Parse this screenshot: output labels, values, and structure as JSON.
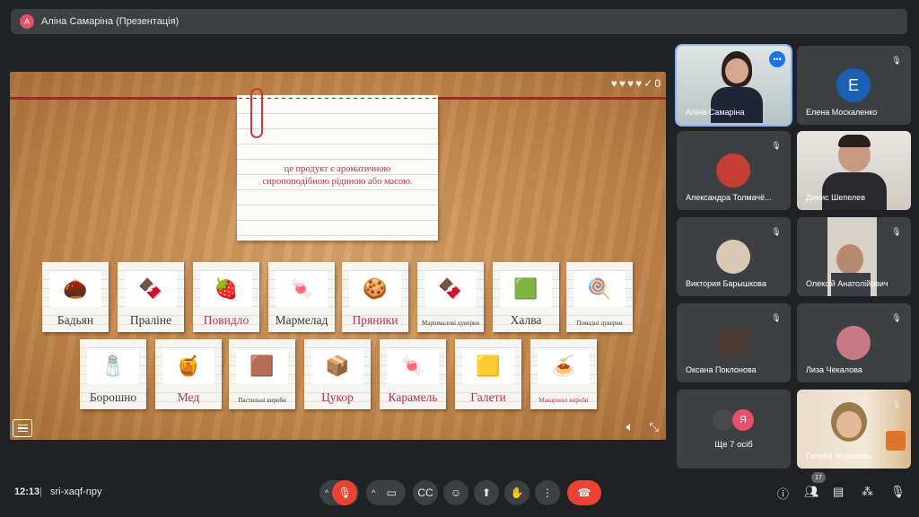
{
  "topbar": {
    "avatar_letter": "A",
    "title": "Аліна Самаріна (Презентація)"
  },
  "slide": {
    "score": "0",
    "question": "це продукт є ароматичною сиропоподібною рідиною або масою.",
    "cards_row1": [
      {
        "label": "Бадьян",
        "icon": "🌰"
      },
      {
        "label": "Праліне",
        "icon": "🍫"
      },
      {
        "label": "Повидло",
        "icon": "🍓"
      },
      {
        "label": "Мармелад",
        "icon": "🍬"
      },
      {
        "label": "Пряники",
        "icon": "🍪"
      },
      {
        "label": "Маршмалові цукерки",
        "icon": "🍫"
      },
      {
        "label": "Халва",
        "icon": "🟩"
      },
      {
        "label": "Помадні цукерки",
        "icon": "🍭"
      }
    ],
    "cards_row2": [
      {
        "label": "Борошно",
        "icon": "🧂"
      },
      {
        "label": "Мед",
        "icon": "🍯"
      },
      {
        "label": "Пастильні вироби",
        "icon": "🟫"
      },
      {
        "label": "Цукор",
        "icon": "📦"
      },
      {
        "label": "Карамель",
        "icon": "🍬"
      },
      {
        "label": "Галети",
        "icon": "🟨"
      },
      {
        "label": "Макаронні вироби",
        "icon": "🍝"
      }
    ]
  },
  "participants": [
    {
      "name": "Аліна Самаріна"
    },
    {
      "name": "Елена Москаленко",
      "letter": "E"
    },
    {
      "name": "Александра Толмачё..."
    },
    {
      "name": "Денис Шепелев"
    },
    {
      "name": "Виктория Барышкова"
    },
    {
      "name": "Олексій Анатолійович"
    },
    {
      "name": "Оксана Поклонова"
    },
    {
      "name": "Лиза Чекалова"
    },
    {
      "name": "Ще 7 осіб",
      "letter": "Я"
    },
    {
      "name": "Галина Журавель"
    }
  ],
  "bottom": {
    "time": "12:13",
    "code": "sri-xaqf-npy",
    "participants_count": "17"
  },
  "colors": {
    "end_call": "#ea4335",
    "active_tile": "#8ab4f8",
    "accent": "#1a73e8"
  }
}
